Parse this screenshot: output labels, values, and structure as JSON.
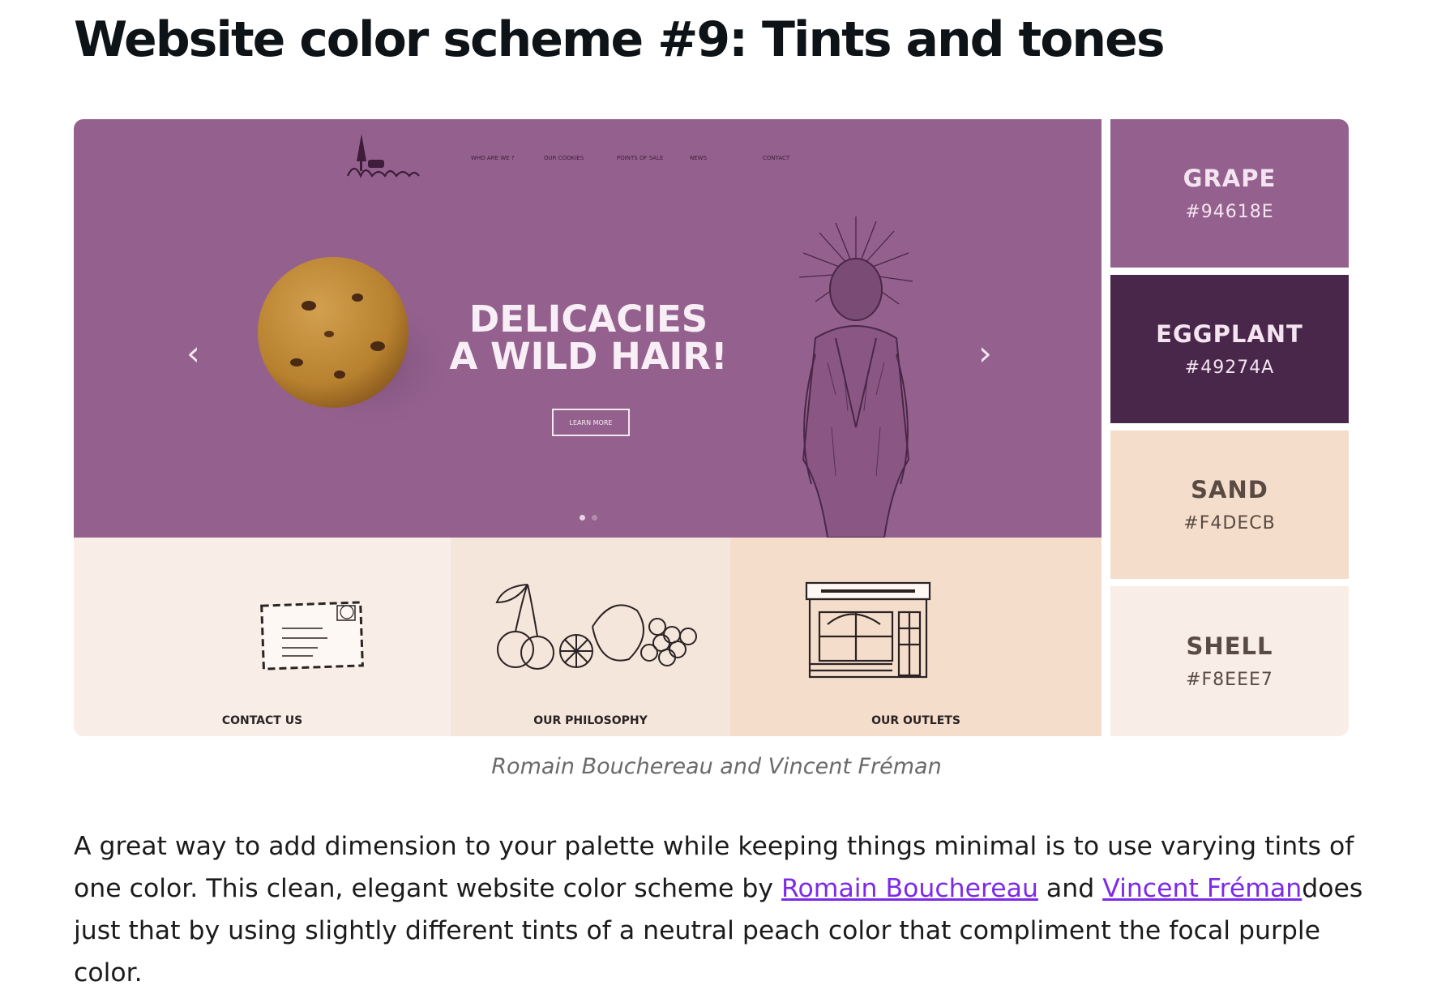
{
  "article": {
    "title": "Website color scheme #9: Tints and tones",
    "caption": "Romain Bouchereau and Vincent Fréman",
    "paragraph": {
      "line1": "A great way to add dimension to your palette while keeping things minimal is to use varying tints of",
      "line2_before": "one color. This clean, elegant website color scheme by ",
      "link1": "Romain Bouchereau",
      "line2_between": " and ",
      "link2": "Vincent Fréman",
      "line2_after": "does",
      "line3": "just that by using slightly different tints of a neutral peach color that compliment the focal purple",
      "line4": "color."
    }
  },
  "mockup": {
    "nav": [
      "Who are we ?",
      "Our cookies",
      "Points of sale",
      "News",
      "Contact"
    ],
    "headline_line1": "DELICACIES",
    "headline_line2": "A WILD HAIR!",
    "cta": "LEARN MORE",
    "prev_arrow": "‹",
    "next_arrow": "›",
    "cards": [
      {
        "label": "CONTACT US",
        "bg": "#f8eee7",
        "icon": "envelope-icon"
      },
      {
        "label": "OUR PHILOSOPHY",
        "bg": "#f4e6da",
        "icon": "fruits-icon"
      },
      {
        "label": "OUR OUTLETS",
        "bg": "#f4decb",
        "icon": "storefront-icon"
      }
    ]
  },
  "palette": [
    {
      "name": "GRAPE",
      "hex": "#94618E",
      "bg": "#94618e",
      "text": "#f4e4f0"
    },
    {
      "name": "EGGPLANT",
      "hex": "#49274A",
      "bg": "#49274a",
      "text": "#f4e4f0"
    },
    {
      "name": "SAND",
      "hex": "#F4DECB",
      "bg": "#f4decb",
      "text": "#5a4a44"
    },
    {
      "name": "SHELL",
      "hex": "#F8EEE7",
      "bg": "#f8eee7",
      "text": "#5a4a44"
    }
  ]
}
